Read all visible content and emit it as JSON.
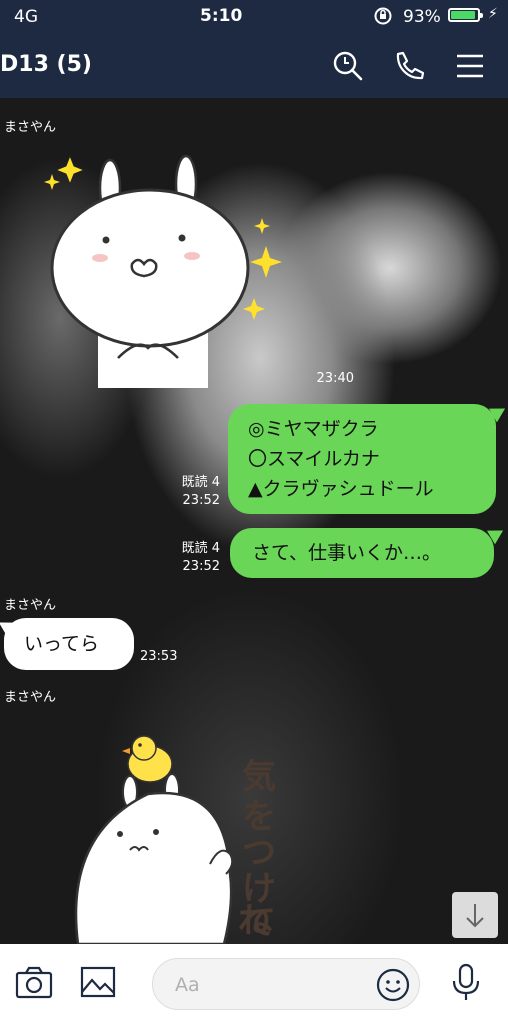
{
  "status": {
    "carrier": "4G",
    "time": "5:10",
    "battery_pct": "93%",
    "battery_level": 0.93
  },
  "header": {
    "title": "D13 (5)",
    "icons": [
      "search-icon",
      "phone-icon",
      "menu-icon"
    ]
  },
  "messages": [
    {
      "sender": "まさやん",
      "type": "sticker",
      "sticker": "rabbit-sparkle-sticker",
      "time": "23:40"
    },
    {
      "type": "text",
      "outgoing": true,
      "lines": [
        "◎ミヤマザクラ",
        "〇スマイルカナ",
        "▲クラヴァシュドール"
      ],
      "read": "既読 4",
      "time": "23:52"
    },
    {
      "type": "text",
      "outgoing": true,
      "text": "さて、仕事いくか…。",
      "read": "既読 4",
      "time": "23:52"
    },
    {
      "sender": "まさやん",
      "type": "text",
      "outgoing": false,
      "text": "いってら",
      "time": "23:53"
    },
    {
      "sender": "まさやん",
      "type": "sticker",
      "sticker": "rabbit-duck-sticker",
      "sticker_text": "気をつけてね"
    }
  ],
  "input": {
    "placeholder": "Aa"
  },
  "toolbar_icons": [
    "camera-icon",
    "image-icon",
    "emoji-icon",
    "microphone-icon",
    "scroll-down-icon"
  ],
  "colors": {
    "header_bg": "#1e2a42",
    "bubble_out": "#6ad657",
    "bubble_in": "#ffffff",
    "battery": "#4cd964"
  }
}
